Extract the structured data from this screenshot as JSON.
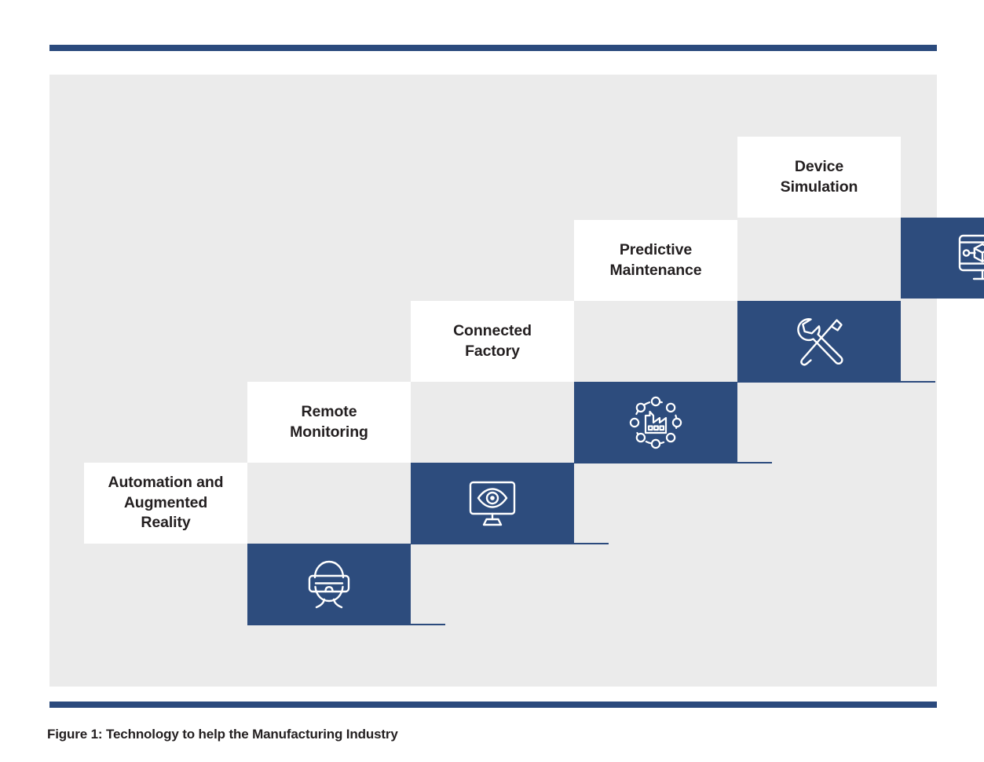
{
  "figure": {
    "caption": "Figure 1: Technology to help the Manufacturing Industry",
    "colors": {
      "rule": "#2b4a7d",
      "panel_background": "#ebebeb",
      "card_background": "#ffffff",
      "icon_block": "#2d4c7d",
      "title_text": "#231f20",
      "connector_line": "#2b4a7d"
    }
  },
  "steps": [
    {
      "title": "Automation and\nAugmented\nReality",
      "icon": "vr-headset-icon",
      "level": 0
    },
    {
      "title": "Remote\nMonitoring",
      "icon": "monitor-eye-icon",
      "level": 1
    },
    {
      "title": "Connected\nFactory",
      "icon": "connected-factory-icon",
      "level": 2
    },
    {
      "title": "Predictive\nMaintenance",
      "icon": "wrench-screwdriver-icon",
      "level": 3
    },
    {
      "title": "Device\nSimulation",
      "icon": "monitor-cube-icon",
      "level": 4
    }
  ]
}
